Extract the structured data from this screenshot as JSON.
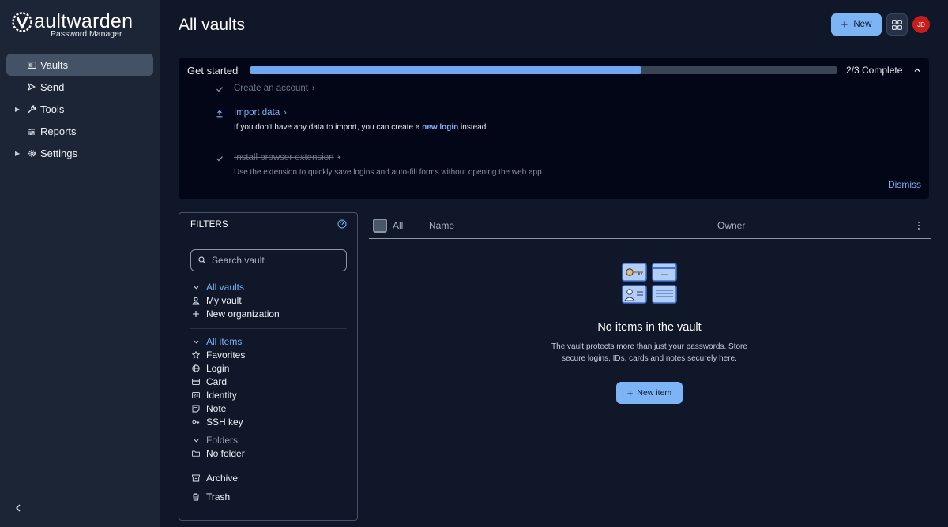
{
  "brand": {
    "name": "aultwarden",
    "subtitle": "Password Manager"
  },
  "sidebar": {
    "items": [
      {
        "label": "Vaults",
        "icon": "vault-icon",
        "active": true
      },
      {
        "label": "Send",
        "icon": "send-icon"
      },
      {
        "label": "Tools",
        "icon": "wrench-icon",
        "expandable": true
      },
      {
        "label": "Reports",
        "icon": "reports-icon"
      },
      {
        "label": "Settings",
        "icon": "gear-icon",
        "expandable": true
      }
    ]
  },
  "header": {
    "title": "All vaults",
    "new_label": "New",
    "avatar_initials": "JD"
  },
  "setup": {
    "title": "Get started",
    "progress_fraction": 0.667,
    "status": "2/3 Complete",
    "tasks": [
      {
        "title": "Create an account",
        "done": true
      },
      {
        "title": "Import data",
        "done": false,
        "desc_before": "If you don't have any data to import, you can create a ",
        "desc_link": "new login",
        "desc_after": " instead."
      },
      {
        "title": "Install browser extension",
        "done": true,
        "desc": "Use the extension to quickly save logins and auto-fill forms without opening the web app."
      }
    ],
    "dismiss_label": "Dismiss"
  },
  "filters": {
    "title": "FILTERS",
    "search_placeholder": "Search vault",
    "vaults_header": "All vaults",
    "vaults": [
      "My vault",
      "New organization"
    ],
    "items_header": "All items",
    "types": [
      "Favorites",
      "Login",
      "Card",
      "Identity",
      "Note",
      "SSH key"
    ],
    "folders_header": "Folders",
    "folders": [
      "No folder"
    ],
    "archive": "Archive",
    "trash": "Trash"
  },
  "table": {
    "select_all": "All",
    "col_name": "Name",
    "col_owner": "Owner"
  },
  "empty": {
    "title": "No items in the vault",
    "desc_line1": "The vault protects more than just your passwords. Store",
    "desc_line2": "secure logins, IDs, cards and notes securely here.",
    "button": "New item"
  },
  "colors": {
    "accent": "#7db4f6",
    "link": "#7cb3f5",
    "background": "#0f1729",
    "sidebar": "#1c2535",
    "avatar": "#c71d1d"
  }
}
